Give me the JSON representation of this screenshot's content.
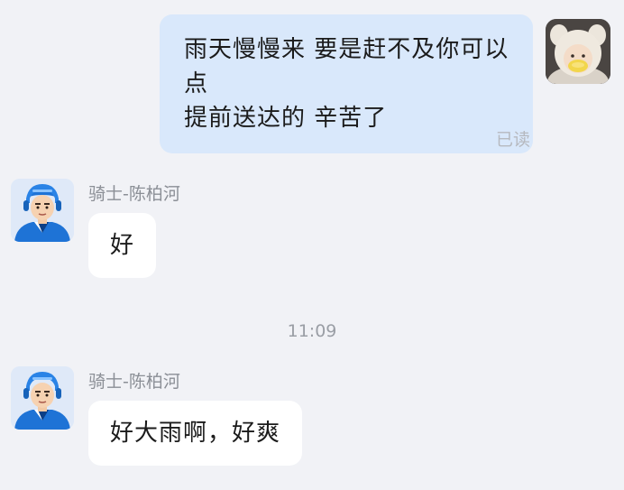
{
  "messages": [
    {
      "direction": "outgoing",
      "text_line1": "雨天慢慢来 要是赶不及你可以点",
      "text_line2": "提前送达的 辛苦了",
      "status": "已读",
      "avatar_icon": "user-photo-avatar-icon"
    },
    {
      "direction": "incoming",
      "sender": "骑士-陈柏河",
      "text": "好",
      "avatar_icon": "rider-helmet-avatar-icon"
    },
    {
      "direction": "incoming",
      "sender": "骑士-陈柏河",
      "text": "好大雨啊，好爽",
      "avatar_icon": "rider-helmet-avatar-icon"
    }
  ],
  "timestamp": "11:09",
  "colors": {
    "background": "#f1f2f6",
    "outgoing_bubble": "#d9e8fb",
    "incoming_bubble": "#ffffff",
    "rider_uniform": "#1e73d6"
  }
}
